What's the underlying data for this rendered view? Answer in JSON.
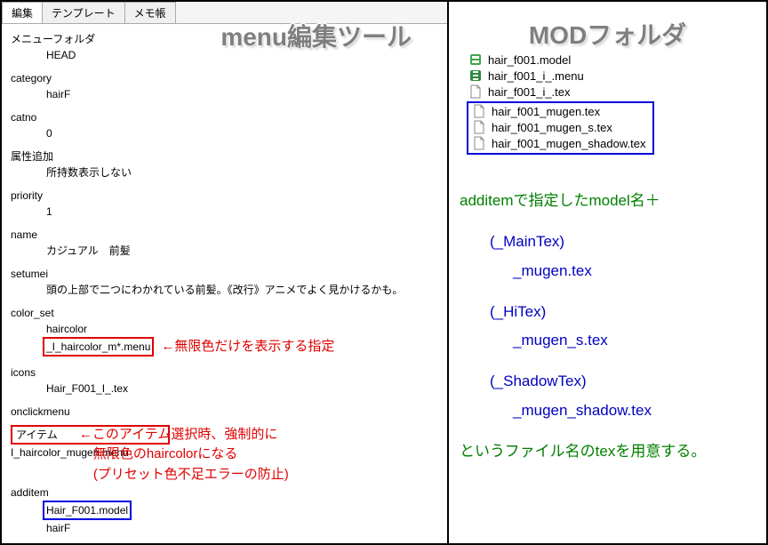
{
  "titles": {
    "left": "menu編集ツール",
    "right": "MODフォルダ"
  },
  "tabs": [
    "編集",
    "テンプレート",
    "メモ帳"
  ],
  "menu": {
    "folder_key": "メニューフォルダ",
    "folder_val": "HEAD",
    "category_key": "category",
    "category_val": "hairF",
    "catno_key": "catno",
    "catno_val": "0",
    "attr_key": "属性追加",
    "attr_val": "所持数表示しない",
    "priority_key": "priority",
    "priority_val": "1",
    "name_key": "name",
    "name_val": "カジュアル　前髪",
    "setumei_key": "setumei",
    "setumei_val": "頭の上部で二つにわかれている前髪。《改行》アニメでよく見かけるかも。",
    "colorset_key": "color_set",
    "colorset_val1": "haircolor",
    "colorset_val2": "_I_haircolor_m*.menu",
    "icons_key": "icons",
    "icons_val": "Hair_F001_I_.tex",
    "onclick_key": "onclickmenu",
    "item_key": "アイテム",
    "item_val": "I_haircolor_mugen.menu",
    "additem_key": "additem",
    "additem_val1": "Hair_F001.model",
    "additem_val2": "hairF"
  },
  "annot": {
    "colorset": "←無限色だけを表示する指定",
    "item_l1": "←このアイテム選択時、強制的に",
    "item_l2": "無限色のhaircolorになる",
    "item_l3": "(プリセット色不足エラーの防止)"
  },
  "files": {
    "normal": [
      "hair_f001.model",
      "hair_f001_i_.menu",
      "hair_f001_i_.tex"
    ],
    "boxed": [
      "hair_f001_mugen.tex",
      "hair_f001_mugen_s.tex",
      "hair_f001_mugen_shadow.tex"
    ]
  },
  "explain": {
    "line1": "additemで指定したmodel名＋",
    "maintex": "(_MainTex)",
    "maintex_val": "_mugen.tex",
    "hitex": "(_HiTex)",
    "hitex_val": "_mugen_s.tex",
    "shadowtex": "(_ShadowTex)",
    "shadowtex_val": "_mugen_shadow.tex",
    "footer": "というファイル名のtexを用意する。"
  }
}
